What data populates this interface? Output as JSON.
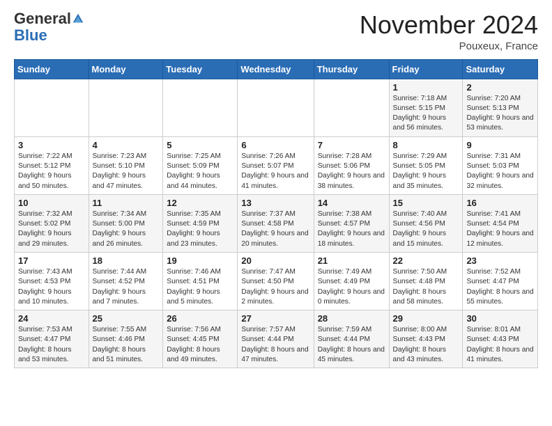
{
  "header": {
    "logo_general": "General",
    "logo_blue": "Blue",
    "month_title": "November 2024",
    "location": "Pouxeux, France"
  },
  "calendar": {
    "days_of_week": [
      "Sunday",
      "Monday",
      "Tuesday",
      "Wednesday",
      "Thursday",
      "Friday",
      "Saturday"
    ],
    "weeks": [
      [
        {
          "day": "",
          "info": ""
        },
        {
          "day": "",
          "info": ""
        },
        {
          "day": "",
          "info": ""
        },
        {
          "day": "",
          "info": ""
        },
        {
          "day": "",
          "info": ""
        },
        {
          "day": "1",
          "info": "Sunrise: 7:18 AM\nSunset: 5:15 PM\nDaylight: 9 hours and 56 minutes."
        },
        {
          "day": "2",
          "info": "Sunrise: 7:20 AM\nSunset: 5:13 PM\nDaylight: 9 hours and 53 minutes."
        }
      ],
      [
        {
          "day": "3",
          "info": "Sunrise: 7:22 AM\nSunset: 5:12 PM\nDaylight: 9 hours and 50 minutes."
        },
        {
          "day": "4",
          "info": "Sunrise: 7:23 AM\nSunset: 5:10 PM\nDaylight: 9 hours and 47 minutes."
        },
        {
          "day": "5",
          "info": "Sunrise: 7:25 AM\nSunset: 5:09 PM\nDaylight: 9 hours and 44 minutes."
        },
        {
          "day": "6",
          "info": "Sunrise: 7:26 AM\nSunset: 5:07 PM\nDaylight: 9 hours and 41 minutes."
        },
        {
          "day": "7",
          "info": "Sunrise: 7:28 AM\nSunset: 5:06 PM\nDaylight: 9 hours and 38 minutes."
        },
        {
          "day": "8",
          "info": "Sunrise: 7:29 AM\nSunset: 5:05 PM\nDaylight: 9 hours and 35 minutes."
        },
        {
          "day": "9",
          "info": "Sunrise: 7:31 AM\nSunset: 5:03 PM\nDaylight: 9 hours and 32 minutes."
        }
      ],
      [
        {
          "day": "10",
          "info": "Sunrise: 7:32 AM\nSunset: 5:02 PM\nDaylight: 9 hours and 29 minutes."
        },
        {
          "day": "11",
          "info": "Sunrise: 7:34 AM\nSunset: 5:00 PM\nDaylight: 9 hours and 26 minutes."
        },
        {
          "day": "12",
          "info": "Sunrise: 7:35 AM\nSunset: 4:59 PM\nDaylight: 9 hours and 23 minutes."
        },
        {
          "day": "13",
          "info": "Sunrise: 7:37 AM\nSunset: 4:58 PM\nDaylight: 9 hours and 20 minutes."
        },
        {
          "day": "14",
          "info": "Sunrise: 7:38 AM\nSunset: 4:57 PM\nDaylight: 9 hours and 18 minutes."
        },
        {
          "day": "15",
          "info": "Sunrise: 7:40 AM\nSunset: 4:56 PM\nDaylight: 9 hours and 15 minutes."
        },
        {
          "day": "16",
          "info": "Sunrise: 7:41 AM\nSunset: 4:54 PM\nDaylight: 9 hours and 12 minutes."
        }
      ],
      [
        {
          "day": "17",
          "info": "Sunrise: 7:43 AM\nSunset: 4:53 PM\nDaylight: 9 hours and 10 minutes."
        },
        {
          "day": "18",
          "info": "Sunrise: 7:44 AM\nSunset: 4:52 PM\nDaylight: 9 hours and 7 minutes."
        },
        {
          "day": "19",
          "info": "Sunrise: 7:46 AM\nSunset: 4:51 PM\nDaylight: 9 hours and 5 minutes."
        },
        {
          "day": "20",
          "info": "Sunrise: 7:47 AM\nSunset: 4:50 PM\nDaylight: 9 hours and 2 minutes."
        },
        {
          "day": "21",
          "info": "Sunrise: 7:49 AM\nSunset: 4:49 PM\nDaylight: 9 hours and 0 minutes."
        },
        {
          "day": "22",
          "info": "Sunrise: 7:50 AM\nSunset: 4:48 PM\nDaylight: 8 hours and 58 minutes."
        },
        {
          "day": "23",
          "info": "Sunrise: 7:52 AM\nSunset: 4:47 PM\nDaylight: 8 hours and 55 minutes."
        }
      ],
      [
        {
          "day": "24",
          "info": "Sunrise: 7:53 AM\nSunset: 4:47 PM\nDaylight: 8 hours and 53 minutes."
        },
        {
          "day": "25",
          "info": "Sunrise: 7:55 AM\nSunset: 4:46 PM\nDaylight: 8 hours and 51 minutes."
        },
        {
          "day": "26",
          "info": "Sunrise: 7:56 AM\nSunset: 4:45 PM\nDaylight: 8 hours and 49 minutes."
        },
        {
          "day": "27",
          "info": "Sunrise: 7:57 AM\nSunset: 4:44 PM\nDaylight: 8 hours and 47 minutes."
        },
        {
          "day": "28",
          "info": "Sunrise: 7:59 AM\nSunset: 4:44 PM\nDaylight: 8 hours and 45 minutes."
        },
        {
          "day": "29",
          "info": "Sunrise: 8:00 AM\nSunset: 4:43 PM\nDaylight: 8 hours and 43 minutes."
        },
        {
          "day": "30",
          "info": "Sunrise: 8:01 AM\nSunset: 4:43 PM\nDaylight: 8 hours and 41 minutes."
        }
      ]
    ]
  }
}
